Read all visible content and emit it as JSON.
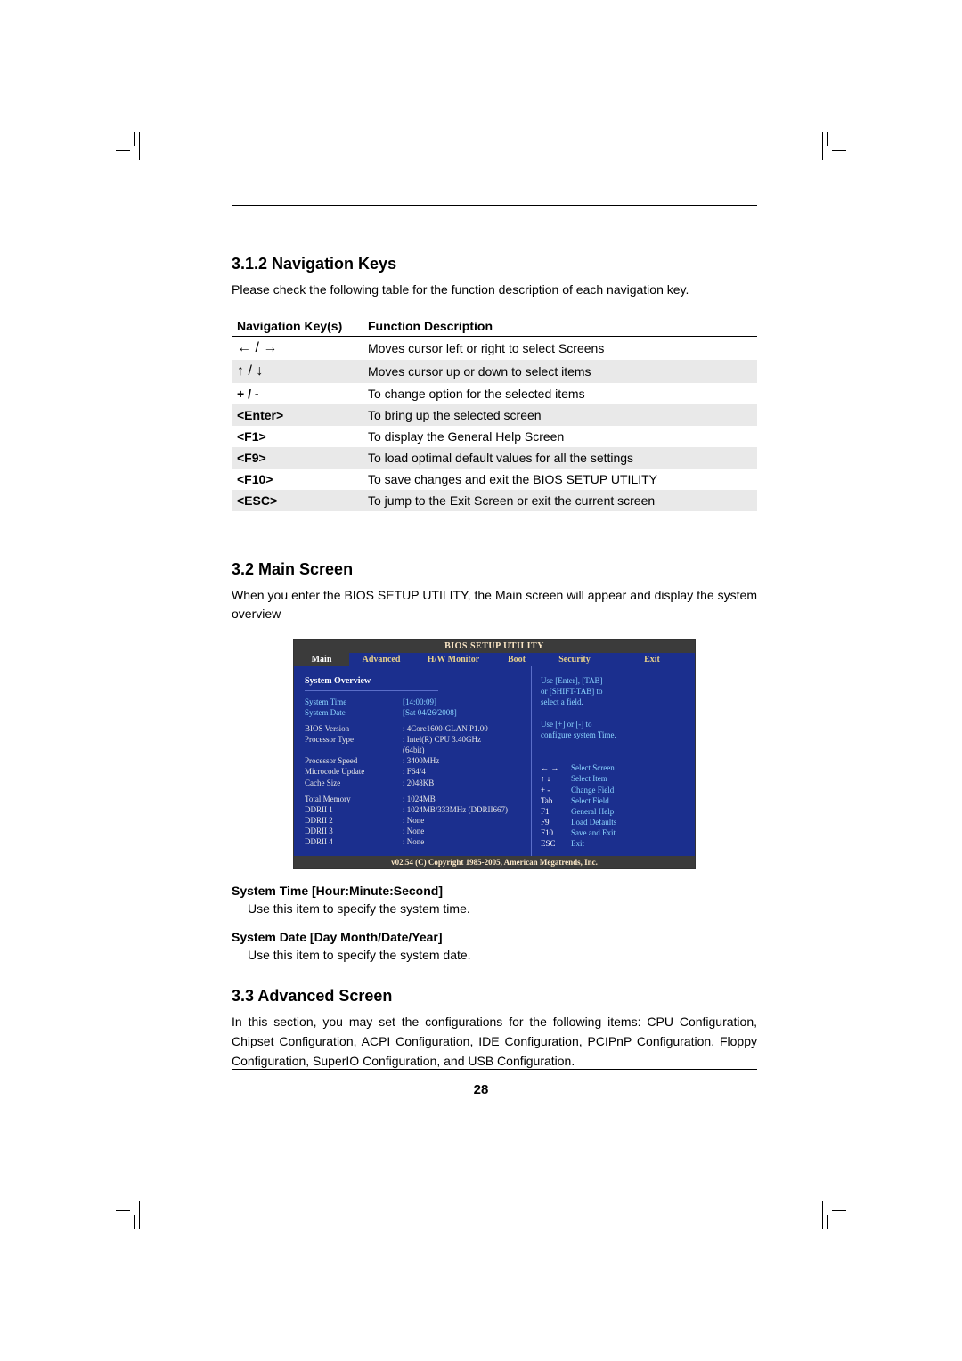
{
  "sections": {
    "s312_title": "3.1.2 Navigation Keys",
    "s312_intro": "Please check the following table for the function description of each navigation key.",
    "s32_title": "3.2  Main Screen",
    "s32_intro": "When you enter the BIOS SETUP UTILITY, the Main screen will appear and display the system overview",
    "s33_title": "3.3  Advanced Screen",
    "s33_intro": "In this section, you may set the configurations for the following items: CPU Configuration, Chipset Configuration, ACPI Configuration, IDE Configuration, PCIPnP Configuration, Floppy Configuration, SuperIO Configuration, and USB Configuration."
  },
  "nav_table": {
    "head_key": "Navigation Key(s)",
    "head_desc": "Function Description",
    "rows": [
      {
        "key_icon": "←  /  →",
        "key_text": "",
        "desc": "Moves cursor left or right to select Screens"
      },
      {
        "key_icon": "↑  /  ↓",
        "key_text": "",
        "desc": "Moves cursor up or down to select items"
      },
      {
        "key_icon": "",
        "key_text": "+  /  -",
        "desc": "To change option for the selected items"
      },
      {
        "key_icon": "",
        "key_text": "<Enter>",
        "desc": "To bring up the selected screen"
      },
      {
        "key_icon": "",
        "key_text": "<F1>",
        "desc": "To display the General Help Screen"
      },
      {
        "key_icon": "",
        "key_text": "<F9>",
        "desc": "To load optimal default values for all the settings"
      },
      {
        "key_icon": "",
        "key_text": "<F10>",
        "desc": "To save changes and exit the BIOS SETUP UTILITY"
      },
      {
        "key_icon": "",
        "key_text": "<ESC>",
        "desc": "To jump to the Exit Screen or exit the current screen"
      }
    ]
  },
  "bios": {
    "title": "BIOS SETUP UTILITY",
    "tabs": {
      "main": "Main",
      "advanced": "Advanced",
      "hw": "H/W Monitor",
      "boot": "Boot",
      "security": "Security",
      "exit": "Exit"
    },
    "overview_label": "System Overview",
    "left_rows": [
      {
        "lbl": "System Time",
        "val": "[14:00:09]",
        "sel": true
      },
      {
        "lbl": "System Date",
        "val": "[Sat 04/26/2008]",
        "sel": true
      }
    ],
    "info_rows": [
      {
        "lbl": "BIOS Version",
        "val": ": 4Core1600-GLAN P1.00"
      },
      {
        "lbl": "Processor Type",
        "val": ": Intel(R)  CPU 3.40GHz"
      },
      {
        "lbl": "",
        "val": "  (64bit)"
      },
      {
        "lbl": "Processor Speed",
        "val": ": 3400MHz"
      },
      {
        "lbl": "Microcode Update",
        "val": ": F64/4"
      },
      {
        "lbl": "Cache Size",
        "val": ": 2048KB"
      }
    ],
    "mem_rows": [
      {
        "lbl": "Total Memory",
        "val": ": 1024MB"
      },
      {
        "lbl": "    DDRII 1",
        "val": ": 1024MB/333MHz (DDRII667)"
      },
      {
        "lbl": "    DDRII 2",
        "val": ": None"
      },
      {
        "lbl": "    DDRII 3",
        "val": ": None"
      },
      {
        "lbl": "    DDRII 4",
        "val": ": None"
      }
    ],
    "help_top": [
      "Use [Enter], [TAB]",
      "or [SHIFT-TAB] to",
      "select a field.",
      "",
      "Use [+] or [-] to",
      "configure system Time."
    ],
    "help_keys": [
      {
        "k": "← →",
        "d": "Select Screen"
      },
      {
        "k": "↑ ↓",
        "d": "Select Item"
      },
      {
        "k": "+ -",
        "d": "Change Field"
      },
      {
        "k": "Tab",
        "d": "Select Field"
      },
      {
        "k": "F1",
        "d": "General Help"
      },
      {
        "k": "F9",
        "d": "Load Defaults"
      },
      {
        "k": "F10",
        "d": "Save and Exit"
      },
      {
        "k": "ESC",
        "d": "Exit"
      }
    ],
    "footer": "v02.54 (C) Copyright 1985-2005, American Megatrends, Inc."
  },
  "fields": {
    "time_head": "System Time [Hour:Minute:Second]",
    "time_desc": "Use this item to specify the system time.",
    "date_head": "System Date [Day Month/Date/Year]",
    "date_desc": "Use this item to specify the system date."
  },
  "page_number": "28"
}
